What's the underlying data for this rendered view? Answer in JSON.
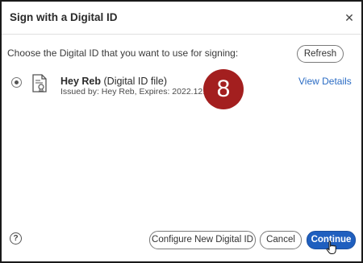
{
  "dialog": {
    "title": "Sign with a Digital ID",
    "close_icon": "close-icon",
    "prompt": "Choose the Digital ID that you want to use for signing:",
    "refresh_label": "Refresh"
  },
  "digital_ids": [
    {
      "name": "Hey Reb",
      "type": "(Digital ID file)",
      "issued": "Issued by: Hey Reb, Expires: 2022.12.28",
      "selected": true,
      "view_details_label": "View Details",
      "icon": "certificate-icon"
    }
  ],
  "step_badge": {
    "number": "8",
    "color": "#a31f1f"
  },
  "footer": {
    "help_icon": "help-icon",
    "help_glyph": "?",
    "configure_label": "Configure New Digital ID",
    "cancel_label": "Cancel",
    "continue_label": "Continue"
  },
  "colors": {
    "accent": "#1f5fbf",
    "link": "#2b6cc4"
  }
}
